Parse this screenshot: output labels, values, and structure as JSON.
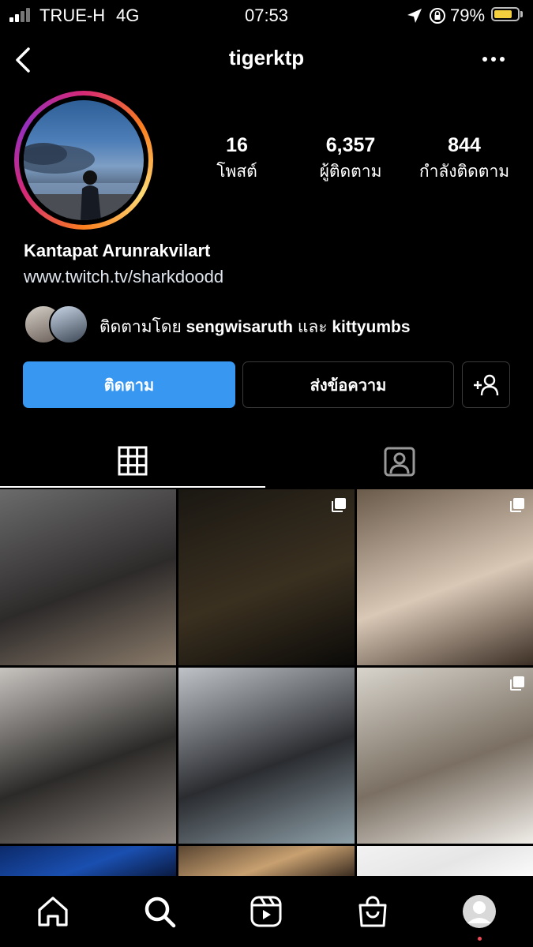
{
  "status_bar": {
    "carrier": "TRUE-H",
    "network": "4G",
    "time": "07:53",
    "battery_percent": "79%",
    "icons": [
      "signal-icon",
      "location-icon",
      "rotation-lock-icon",
      "battery-icon"
    ]
  },
  "header": {
    "username": "tigerktp",
    "icons": [
      "back-chevron-icon",
      "more-dots-icon"
    ]
  },
  "profile": {
    "stats": [
      {
        "value": "16",
        "label": "โพสต์"
      },
      {
        "value": "6,357",
        "label": "ผู้ติดตาม"
      },
      {
        "value": "844",
        "label": "กำลังติดตาม"
      }
    ],
    "display_name": "Kantapat Arunrakvilart",
    "bio_link": "www.twitch.tv/sharkdoodd",
    "followed_by": {
      "prefix": "ติดตามโดย ",
      "user1": "sengwisaruth",
      "conjunction": " และ ",
      "user2": "kittyumbs"
    }
  },
  "actions": {
    "follow_label": "ติดตาม",
    "message_label": "ส่งข้อความ",
    "add_user_icon": "add-person-icon"
  },
  "tabs": [
    {
      "icon": "grid-icon",
      "active": true
    },
    {
      "icon": "tagged-icon",
      "active": false
    }
  ],
  "posts": [
    {
      "multi": false,
      "colors": [
        "#6b6b6b",
        "#2d2a2a",
        "#8a7b6a"
      ]
    },
    {
      "multi": true,
      "colors": [
        "#1a1712",
        "#3a3020",
        "#0b0a08"
      ]
    },
    {
      "multi": true,
      "colors": [
        "#6a5a4a",
        "#d9c8b6",
        "#3c2f25"
      ]
    },
    {
      "multi": false,
      "colors": [
        "#c7c4c0",
        "#2c2a28",
        "#8c8580"
      ]
    },
    {
      "multi": false,
      "colors": [
        "#bfc3c8",
        "#2a2c30",
        "#8fa0a8"
      ]
    },
    {
      "multi": true,
      "colors": [
        "#d8d4cc",
        "#7a6f62",
        "#f0ede8"
      ]
    },
    {
      "multi": false,
      "colors": [
        "#0c2a6a",
        "#1a4fb0",
        "#0a1a40"
      ]
    },
    {
      "multi": false,
      "colors": [
        "#5a4632",
        "#c8a070",
        "#3a2c20"
      ]
    },
    {
      "multi": false,
      "colors": [
        "#f2f2f2",
        "#e6e6e6",
        "#fafafa"
      ]
    }
  ],
  "bottom_nav": [
    "home-icon",
    "search-icon",
    "reels-icon",
    "shop-icon",
    "profile-avatar-icon"
  ],
  "accent": "#3897f0"
}
